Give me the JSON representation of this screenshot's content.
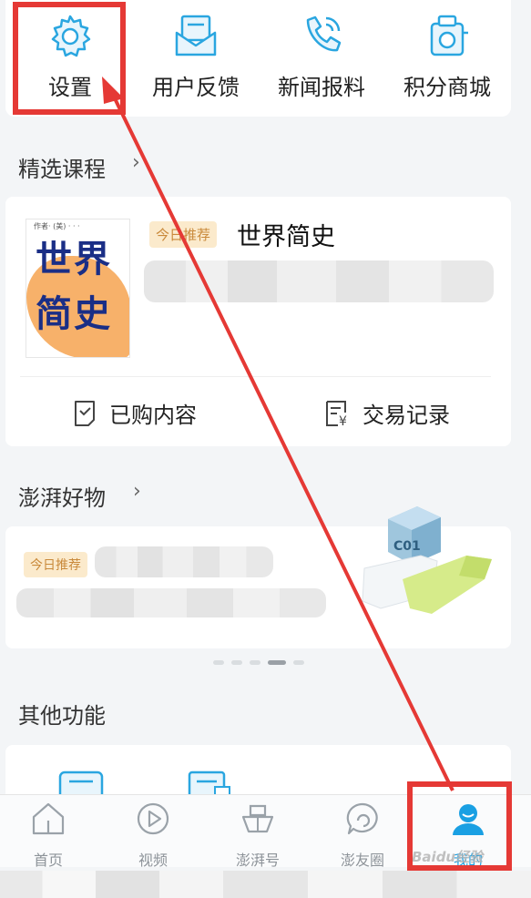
{
  "quick": {
    "items": [
      {
        "label": "设置",
        "icon": "gear-icon"
      },
      {
        "label": "用户反馈",
        "icon": "envelope-icon"
      },
      {
        "label": "新闻报料",
        "icon": "phone-icon"
      },
      {
        "label": "积分商城",
        "icon": "shop-icon"
      }
    ]
  },
  "course": {
    "section_title": "精选课程",
    "badge": "今日推荐",
    "title": "世界简史",
    "cover_title_1": "世界",
    "cover_title_2": "简史",
    "actions": [
      {
        "label": "已购内容",
        "icon": "purchased-icon"
      },
      {
        "label": "交易记录",
        "icon": "receipt-icon"
      }
    ]
  },
  "goods": {
    "section_title": "澎湃好物",
    "badge": "今日推荐",
    "product_code": "C01"
  },
  "other": {
    "section_title": "其他功能"
  },
  "tabbar": {
    "tabs": [
      {
        "label": "首页",
        "icon": "home-icon"
      },
      {
        "label": "视频",
        "icon": "play-icon"
      },
      {
        "label": "澎湃号",
        "icon": "ship-icon"
      },
      {
        "label": "澎友圈",
        "icon": "chat-icon"
      },
      {
        "label": "我的",
        "icon": "user-icon"
      }
    ]
  },
  "colors": {
    "accent": "#1aa0e3",
    "annotation": "#e53935",
    "badge_bg": "#fbeacc"
  },
  "watermark": "Baidu经验"
}
